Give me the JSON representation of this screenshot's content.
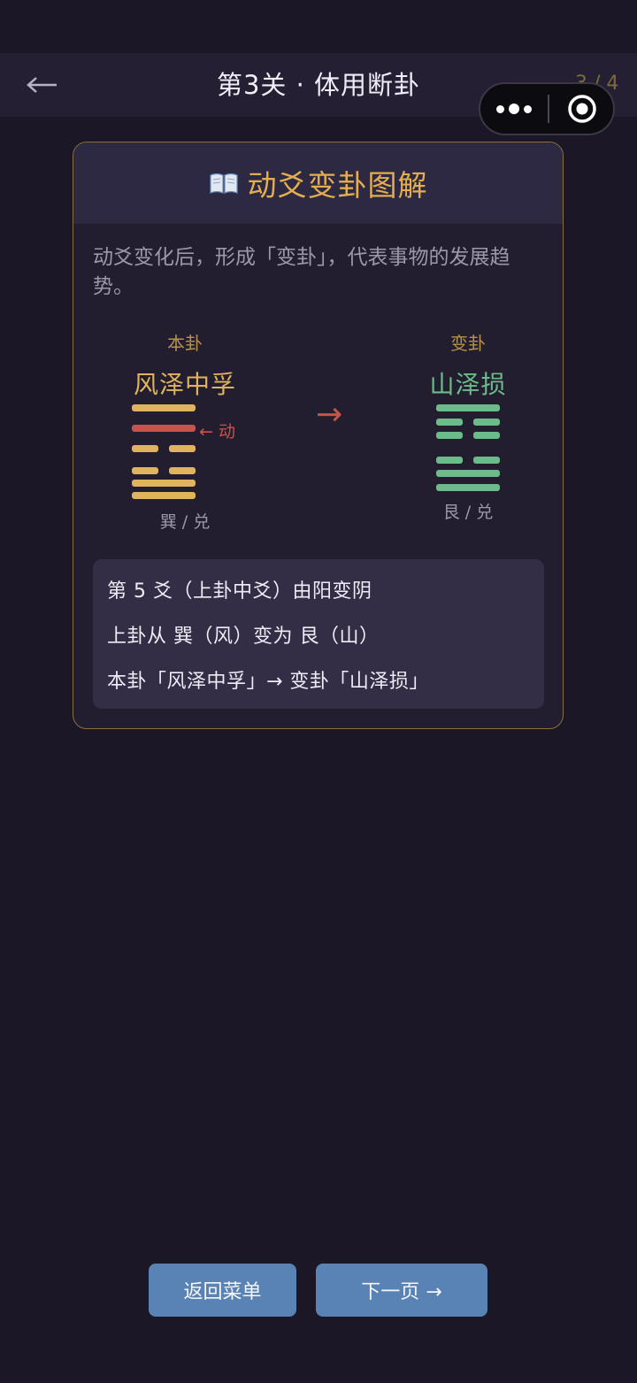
{
  "navbar": {
    "back_icon": "arrow-left-icon",
    "title": "第3关 · 体用断卦",
    "progress": "3 / 4"
  },
  "capsule": {
    "more_icon": "more-dots-icon",
    "close_icon": "target-circle-icon"
  },
  "card": {
    "icon": "open-book-icon",
    "title": "动爻变卦图解",
    "intro": "动爻变化后，形成「变卦」，代表事物的发展趋势。",
    "original": {
      "label": "本卦",
      "name": "风泽中孚",
      "trigrams": "巽 / 兑",
      "color": "#e0b35c",
      "lines_top_to_bottom": [
        "yang",
        "yang-moving",
        "yin",
        "yin",
        "yang",
        "yang"
      ]
    },
    "moving_marker": "← 动",
    "transform_arrow": "→",
    "changed": {
      "label": "变卦",
      "name": "山泽损",
      "trigrams": "艮 / 兑",
      "color": "#6cbb8a",
      "lines_top_to_bottom": [
        "yang",
        "yin",
        "yin",
        "yin",
        "yang",
        "yang"
      ]
    },
    "moving_color": "#c8534a",
    "info": {
      "line1": "第 5 爻（上卦中爻）由阳变阴",
      "line2": "上卦从 巽（风）变为 艮（山）",
      "line3": "本卦「风泽中孚」→ 变卦「山泽损」"
    }
  },
  "buttons": {
    "back_to_menu": "返回菜单",
    "next_page": "下一页 →"
  }
}
